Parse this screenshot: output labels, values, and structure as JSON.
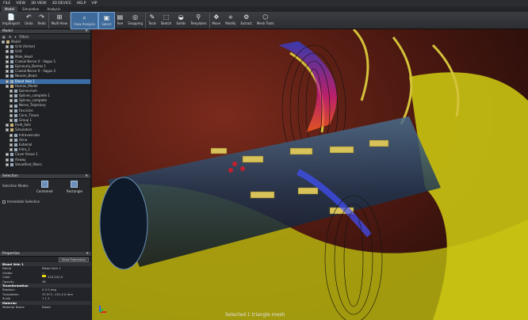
{
  "menu": [
    "FILE",
    "VIEW",
    "3D VIEW",
    "3D DEVICE",
    "HELP",
    "VIP"
  ],
  "tabs": [
    "Model",
    "Simulation",
    "Analysis"
  ],
  "ribbon": [
    {
      "icon": "📄",
      "label": "Imp/Export"
    },
    {
      "icon": "↶",
      "label": "Undo"
    },
    {
      "icon": "↷",
      "label": "Redo"
    },
    {
      "icon": "⊞",
      "label": "Multi-View"
    },
    {
      "icon": "⌕",
      "label": "View Analysis"
    },
    {
      "icon": "▣",
      "label": "Select"
    },
    {
      "icon": "▤",
      "label": "See"
    },
    {
      "icon": "◎",
      "label": "Snapping"
    },
    {
      "icon": "✎",
      "label": "Tools"
    },
    {
      "icon": "⬚",
      "label": "Sketch"
    },
    {
      "icon": "◒",
      "label": "Solids"
    },
    {
      "icon": "⚲",
      "label": "Templates"
    },
    {
      "icon": "✥",
      "label": "Move"
    },
    {
      "icon": "⟡",
      "label": "Modify"
    },
    {
      "icon": "⚙",
      "label": "Extract"
    },
    {
      "icon": "⬡",
      "label": "Mesh Tools"
    }
  ],
  "model_panel": {
    "title": "Model",
    "filters": "Filters",
    "tree": [
      {
        "label": "Model",
        "indent": 0,
        "fold": true
      },
      {
        "label": "Grid (Active)",
        "indent": 1
      },
      {
        "label": "Grid",
        "indent": 1
      },
      {
        "label": "Male_Head",
        "indent": 1
      },
      {
        "label": "Cranial Nerve X - Vagus 1",
        "indent": 1
      },
      {
        "label": "Epineuria_Dermis 1",
        "indent": 1
      },
      {
        "label": "Cranial Nerve X - Vagus 2",
        "indent": 1
      },
      {
        "label": "Neuron_Beam",
        "indent": 1
      },
      {
        "label": "Blood Vein 1",
        "indent": 1,
        "sel": true
      },
      {
        "label": "Human_Model",
        "indent": 1,
        "fold": true
      },
      {
        "label": "Epineurium",
        "indent": 2
      },
      {
        "label": "Splines_complete 1",
        "indent": 2
      },
      {
        "label": "Splines_complete",
        "indent": 2
      },
      {
        "label": "Nerve_Trajectory",
        "indent": 2
      },
      {
        "label": "Fascicles",
        "indent": 2
      },
      {
        "label": "Conn_Tissue",
        "indent": 2
      },
      {
        "label": "Group 1",
        "indent": 2
      },
      {
        "label": "Field_Sets",
        "indent": 1,
        "fold": true
      },
      {
        "label": "Simulators",
        "indent": 1,
        "fold": true
      },
      {
        "label": "Intravascular",
        "indent": 2
      },
      {
        "label": "Anna",
        "indent": 2
      },
      {
        "label": "Extemal",
        "indent": 2
      },
      {
        "label": "Intra_1",
        "indent": 2
      },
      {
        "label": "Cover tissue 1",
        "indent": 1
      },
      {
        "label": "Airway",
        "indent": 1
      },
      {
        "label": "Smoothed_fibers",
        "indent": 1
      }
    ]
  },
  "selection_panel": {
    "title": "Selection",
    "modes_label": "Selection Modes",
    "contained": "Contained",
    "rectangle": "Rectangle",
    "immediate": "Immediate Selection"
  },
  "properties_panel": {
    "title": "Properties",
    "expr_button": "Show Expression",
    "object": "Blood Vein 1",
    "rows": [
      {
        "k": "Name",
        "v": "Blood Vein 1"
      },
      {
        "k": "Visible",
        "v": "✓"
      },
      {
        "k": "Color",
        "v": "224,242,5"
      },
      {
        "k": "Opacity",
        "v": "38"
      }
    ],
    "transformation": "Transformation",
    "rotation": {
      "k": "Rotation",
      "v": "0    0    0",
      "u": "deg"
    },
    "translation": {
      "k": "Translation",
      "v": "37.971  -131.4    0",
      "u": "mm"
    },
    "scale": {
      "k": "Scale",
      "v": "1    1    1"
    },
    "material": "Material",
    "material_name": {
      "k": "Material Name",
      "v": "Blood"
    }
  },
  "viewport": {
    "status": "Selected 1 triangle mesh"
  }
}
